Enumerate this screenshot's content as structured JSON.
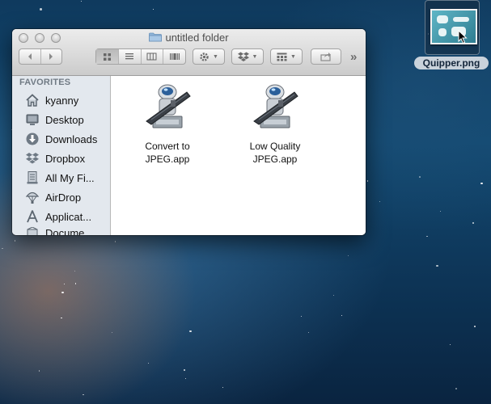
{
  "desktop": {
    "icon_label": "Quipper.png"
  },
  "window": {
    "title": "untitled folder",
    "toolbar": {
      "back_icon": "chevron-left-icon",
      "forward_icon": "chevron-right-icon",
      "view_modes": [
        "icon-view-icon",
        "list-view-icon",
        "column-view-icon",
        "coverflow-view-icon"
      ],
      "active_view": "icon-view-icon",
      "action_icon": "gear-icon",
      "dropbox_icon": "dropbox-icon",
      "arrange_icon": "arrange-grid-icon",
      "share_icon": "share-icon",
      "overflow_label": "»"
    },
    "sidebar": {
      "header": "FAVORITES",
      "items": [
        {
          "label": "kyanny",
          "icon": "home-icon"
        },
        {
          "label": "Desktop",
          "icon": "desktop-icon"
        },
        {
          "label": "Downloads",
          "icon": "downloads-icon"
        },
        {
          "label": "Dropbox",
          "icon": "dropbox-icon"
        },
        {
          "label": "All My Fi...",
          "icon": "all-my-files-icon"
        },
        {
          "label": "AirDrop",
          "icon": "airdrop-icon"
        },
        {
          "label": "Applicat...",
          "icon": "applications-icon"
        },
        {
          "label": "Docume...",
          "icon": "documents-icon"
        }
      ]
    },
    "files": [
      {
        "name_line1": "Convert to",
        "name_line2": "JPEG.app",
        "icon": "automator-robot-icon"
      },
      {
        "name_line1": "Low Quality",
        "name_line2": "JPEG.app",
        "icon": "automator-robot-icon"
      }
    ]
  }
}
